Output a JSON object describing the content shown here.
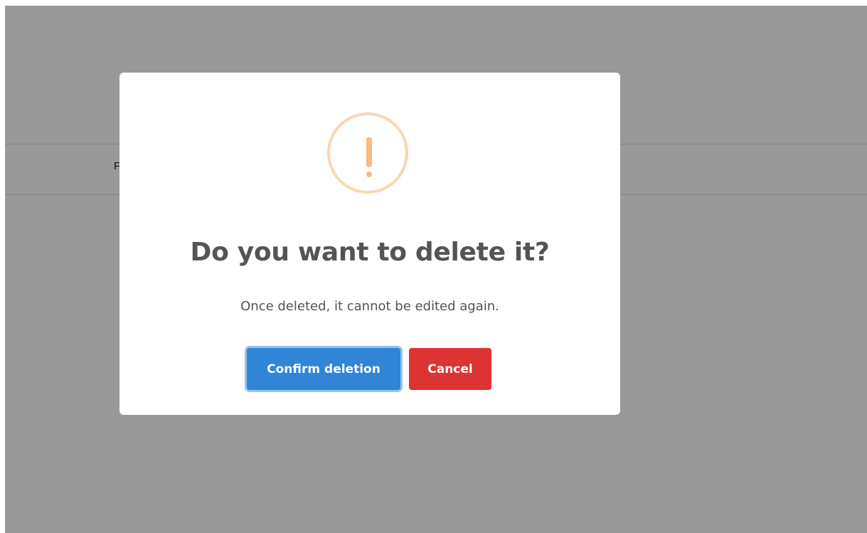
{
  "page": {
    "band_label": "F"
  },
  "modal": {
    "icon": "warning-exclamation-icon",
    "icon_color": "#f8bb86",
    "title": "Do you want to delete it?",
    "text": "Once deleted, it cannot be edited again.",
    "confirm_label": "Confirm deletion",
    "confirm_color": "#3085d6",
    "cancel_label": "Cancel",
    "cancel_color": "#dd3333"
  }
}
